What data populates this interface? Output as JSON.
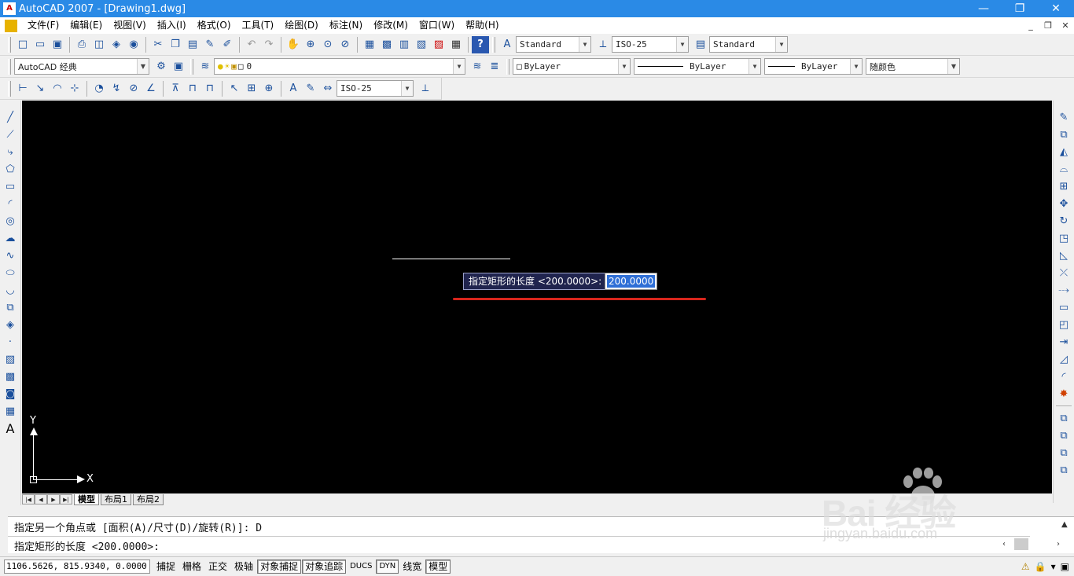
{
  "window": {
    "title": "AutoCAD 2007 - [Drawing1.dwg]",
    "app_icon": "AutoCAD",
    "minimize_glyph": "—",
    "maximize_glyph": "❐",
    "close_glyph": "✕"
  },
  "menu": {
    "items": [
      "文件(F)",
      "编辑(E)",
      "视图(V)",
      "插入(I)",
      "格式(O)",
      "工具(T)",
      "绘图(D)",
      "标注(N)",
      "修改(M)",
      "窗口(W)",
      "帮助(H)"
    ],
    "mdi_minimize": "_",
    "mdi_restore": "❐",
    "mdi_close": "✕"
  },
  "toolbar1": {
    "text_style": "Standard",
    "dim_style": "ISO-25",
    "table_style": "Standard"
  },
  "toolbar2": {
    "workspace": "AutoCAD 经典",
    "layer": "0",
    "color": "ByLayer",
    "linetype": "ByLayer",
    "lineweight": "ByLayer",
    "plot_style": "随颜色"
  },
  "toolbar3": {
    "dim_style": "ISO-25"
  },
  "canvas": {
    "dyn_prompt": "指定矩形的长度 <200.0000>:",
    "dyn_value": "200.0000",
    "ucs_y": "Y",
    "ucs_x": "X"
  },
  "tabs": {
    "items": [
      "模型",
      "布局1",
      "布局2"
    ],
    "active": "模型"
  },
  "command": {
    "history_line": "指定另一个角点或 [面积(A)/尺寸(D)/旋转(R)]: D",
    "current_line": "指定矩形的长度 <200.0000>:"
  },
  "status": {
    "coordinates": "1106.5626, 815.9340, 0.0000",
    "buttons": [
      {
        "label": "捕捉",
        "on": false
      },
      {
        "label": "栅格",
        "on": false
      },
      {
        "label": "正交",
        "on": false
      },
      {
        "label": "极轴",
        "on": false
      },
      {
        "label": "对象捕捉",
        "on": true
      },
      {
        "label": "对象追踪",
        "on": true
      },
      {
        "label": "DUCS",
        "on": false
      },
      {
        "label": "DYN",
        "on": true
      },
      {
        "label": "线宽",
        "on": false
      },
      {
        "label": "模型",
        "on": true
      }
    ]
  },
  "watermark": {
    "text": "Bai 经验",
    "url": "jingyan.baidu.com"
  }
}
